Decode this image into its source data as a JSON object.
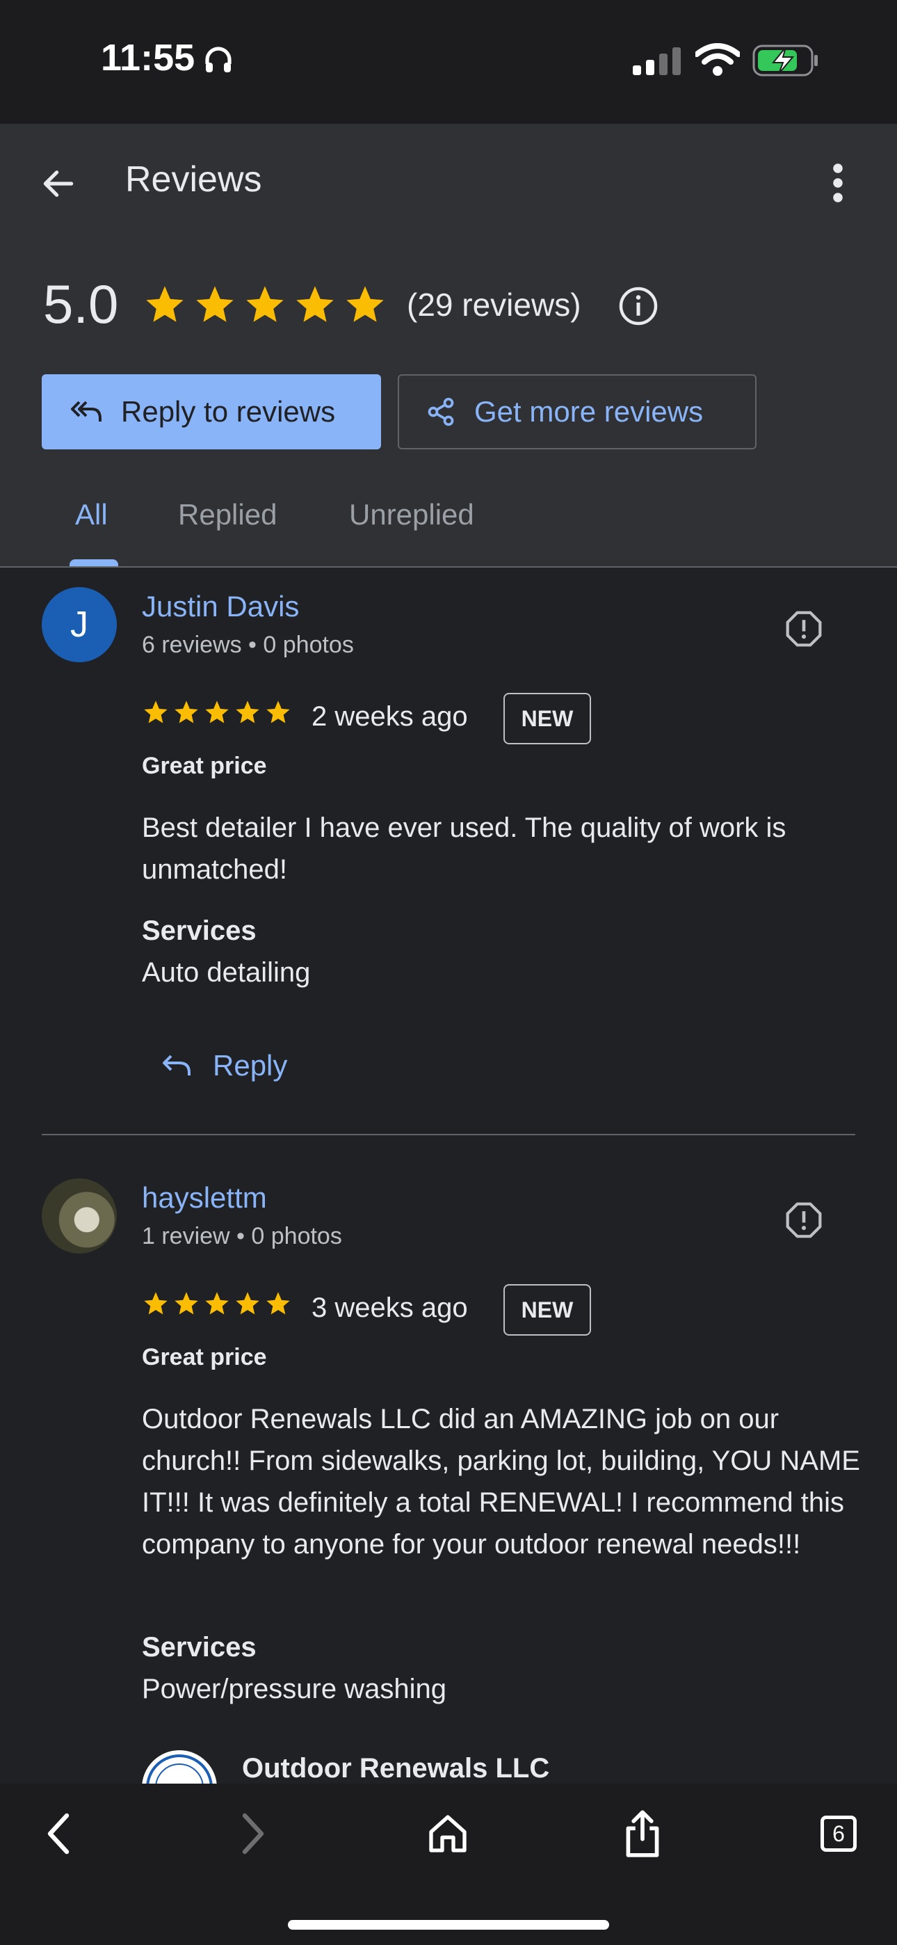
{
  "status": {
    "time": "11:55"
  },
  "header": {
    "title": "Reviews",
    "rating": "5.0",
    "review_count": "(29 reviews)",
    "reply_button": "Reply to reviews",
    "get_more_button": "Get more reviews",
    "tabs": [
      {
        "label": "All"
      },
      {
        "label": "Replied"
      },
      {
        "label": "Unreplied"
      }
    ],
    "active_tab": "All"
  },
  "reviews": [
    {
      "name": "Justin Davis",
      "initial": "J",
      "meta": "6 reviews • 0 photos",
      "stars": 5,
      "time": "2 weeks ago",
      "badge": "NEW",
      "tag": "Great price",
      "text": "Best detailer I have ever used. The quality of work is unmatched!",
      "services_label": "Services",
      "services": "Auto detailing",
      "reply_label": "Reply"
    },
    {
      "name": "hayslettm",
      "meta": "1 review • 0 photos",
      "stars": 5,
      "time": "3 weeks ago",
      "badge": "NEW",
      "tag": "Great price",
      "text": "Outdoor Renewals LLC did an AMAZING job on our church!! From sidewalks, parking lot, building, YOU NAME IT!!! It was definitely a total RENEWAL! I recommend this company to anyone for your outdoor renewal needs!!!",
      "services_label": "Services",
      "services": "Power/pressure washing",
      "owner_name": "Outdoor Renewals LLC"
    }
  ],
  "bottom_bar": {
    "tab_count": "6"
  },
  "colors": {
    "accent": "#8ab4f8",
    "star": "#fbbc04",
    "background": "#202124",
    "header": "#303134"
  }
}
